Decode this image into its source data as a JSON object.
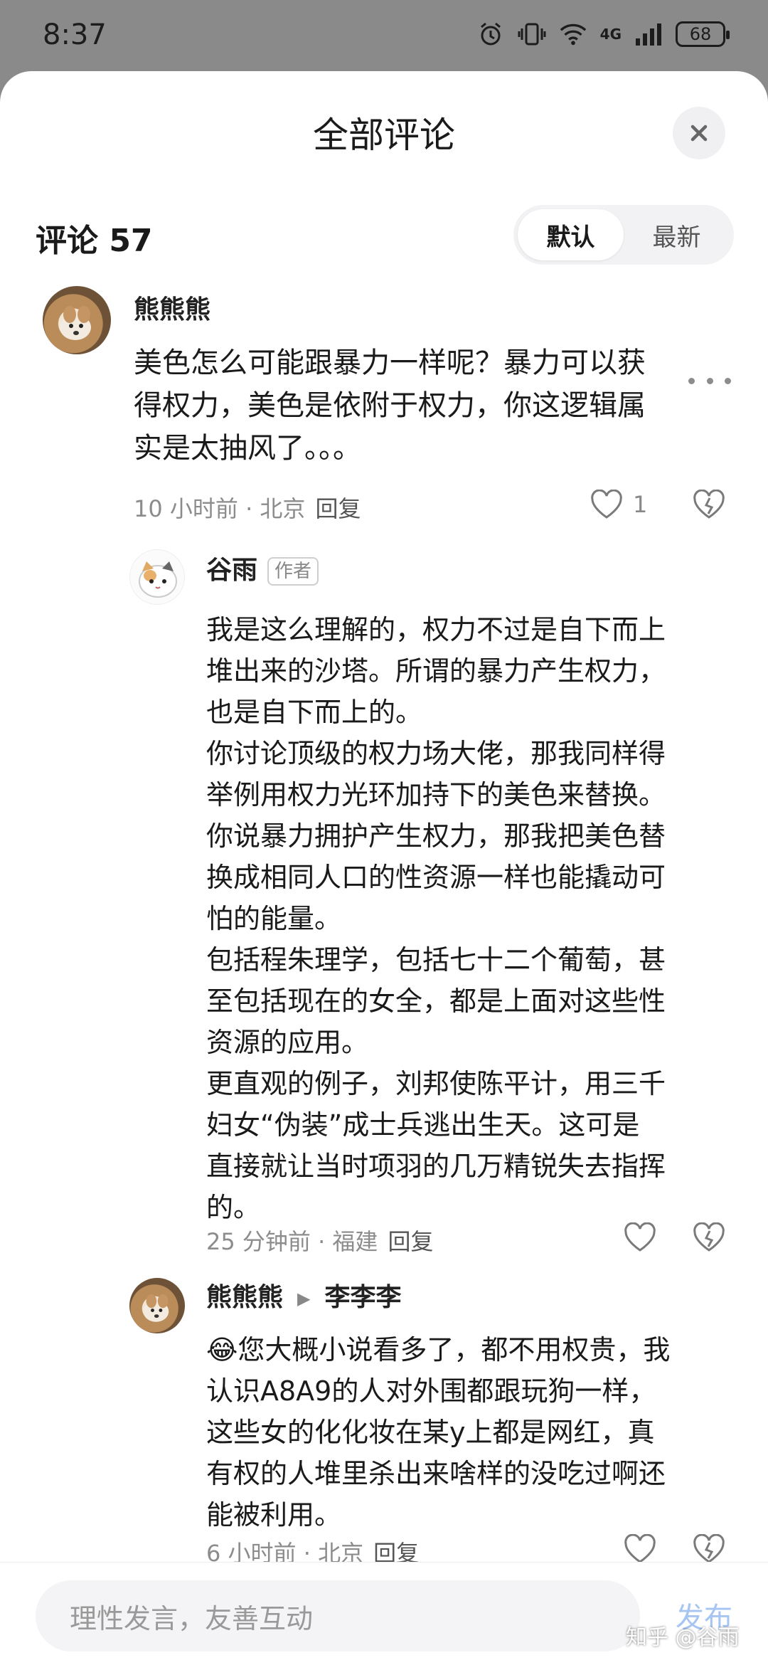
{
  "status_bar": {
    "time": "8:37",
    "battery": "68",
    "network": "4G"
  },
  "sheet": {
    "title": "全部评论"
  },
  "comments_header": {
    "label": "评论 57",
    "sort_options": [
      "默认",
      "最新"
    ]
  },
  "comments": [
    {
      "author": "熊熊熊",
      "lines": [
        "美色怎么可能跟暴力一样呢？暴力可以获",
        "得权力，美色是依附于权力，你这逻辑属",
        "实是太抽风了。。。"
      ],
      "time": "10 小时前",
      "location": "北京",
      "reply_label": "回复",
      "likes": "1"
    },
    {
      "author": "谷雨",
      "badge": "作者",
      "lines": [
        "我是这么理解的，权力不过是自下而上",
        "堆出来的沙塔。所谓的暴力产生权力，",
        "也是自下而上的。",
        "你讨论顶级的权力场大佬，那我同样得",
        "举例用权力光环加持下的美色来替换。",
        "你说暴力拥护产生权力，那我把美色替",
        "换成相同人口的性资源一样也能撬动可",
        "怕的能量。",
        "包括程朱理学，包括七十二个葡萄，甚",
        "至包括现在的女全，都是上面对这些性",
        "资源的应用。",
        "更直观的例子，刘邦使陈平计，用三千",
        "妇女“伪装”成士兵逃出生天。这可是",
        "直接就让当时项羽的几万精锐失去指挥",
        "的。"
      ],
      "time": "25 分钟前",
      "location": "福建",
      "reply_label": "回复"
    },
    {
      "author": "熊熊熊",
      "reply_to": "李李李",
      "lines": [
        "😂您大概小说看多了，都不用权贵，我",
        "认识A8A9的人对外围都跟玩狗一样，",
        "这些女的化化妆在某y上都是网红，真",
        "有权的人堆里杀出来啥样的没吃过啊还",
        "能被利用。"
      ],
      "time": "6 小时前",
      "location": "北京",
      "reply_label": "回复"
    }
  ],
  "input": {
    "placeholder": "理性发言，友善互动",
    "send_label": "发布"
  },
  "watermark": "知乎 @谷雨"
}
